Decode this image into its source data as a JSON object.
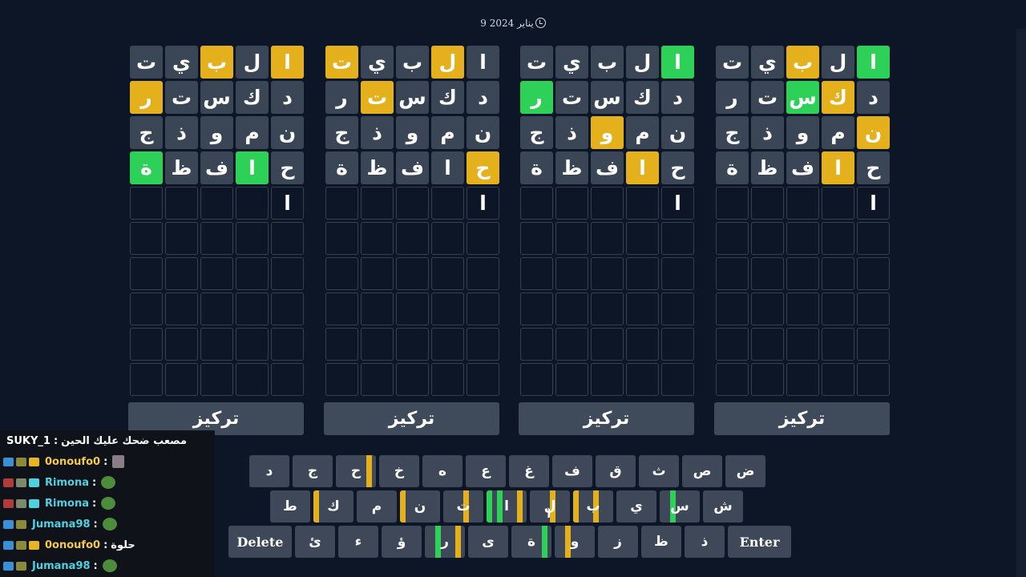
{
  "header": {
    "date": "9 يناير 2024",
    "clock_icon": "clock-icon"
  },
  "colors": {
    "background": "#0d1626",
    "tile_gray": "#3a4556",
    "tile_yellow": "#e4b01c",
    "tile_green": "#2ed158",
    "key": "#3e4859"
  },
  "boards": [
    {
      "focus_label": "تركيز",
      "rows": [
        [
          {
            "l": "ا",
            "s": "yellow"
          },
          {
            "l": "ل",
            "s": "gray"
          },
          {
            "l": "ب",
            "s": "yellow"
          },
          {
            "l": "ي",
            "s": "gray"
          },
          {
            "l": "ت",
            "s": "gray"
          }
        ],
        [
          {
            "l": "د",
            "s": "gray"
          },
          {
            "l": "ك",
            "s": "gray"
          },
          {
            "l": "س",
            "s": "gray"
          },
          {
            "l": "ت",
            "s": "gray"
          },
          {
            "l": "ر",
            "s": "yellow"
          }
        ],
        [
          {
            "l": "ن",
            "s": "gray"
          },
          {
            "l": "م",
            "s": "gray"
          },
          {
            "l": "و",
            "s": "gray"
          },
          {
            "l": "ذ",
            "s": "gray"
          },
          {
            "l": "ج",
            "s": "gray"
          }
        ],
        [
          {
            "l": "ح",
            "s": "gray"
          },
          {
            "l": "ا",
            "s": "green"
          },
          {
            "l": "ف",
            "s": "gray"
          },
          {
            "l": "ظ",
            "s": "gray"
          },
          {
            "l": "ة",
            "s": "green"
          }
        ],
        [
          {
            "l": "ا",
            "s": "typed"
          },
          {
            "l": "",
            "s": "empty"
          },
          {
            "l": "",
            "s": "empty"
          },
          {
            "l": "",
            "s": "empty"
          },
          {
            "l": "",
            "s": "empty"
          }
        ]
      ]
    },
    {
      "focus_label": "تركيز",
      "rows": [
        [
          {
            "l": "ا",
            "s": "gray"
          },
          {
            "l": "ل",
            "s": "yellow"
          },
          {
            "l": "ب",
            "s": "gray"
          },
          {
            "l": "ي",
            "s": "gray"
          },
          {
            "l": "ت",
            "s": "yellow"
          }
        ],
        [
          {
            "l": "د",
            "s": "gray"
          },
          {
            "l": "ك",
            "s": "gray"
          },
          {
            "l": "س",
            "s": "gray"
          },
          {
            "l": "ت",
            "s": "yellow"
          },
          {
            "l": "ر",
            "s": "gray"
          }
        ],
        [
          {
            "l": "ن",
            "s": "gray"
          },
          {
            "l": "م",
            "s": "gray"
          },
          {
            "l": "و",
            "s": "gray"
          },
          {
            "l": "ذ",
            "s": "gray"
          },
          {
            "l": "ج",
            "s": "gray"
          }
        ],
        [
          {
            "l": "ح",
            "s": "yellow"
          },
          {
            "l": "ا",
            "s": "gray"
          },
          {
            "l": "ف",
            "s": "gray"
          },
          {
            "l": "ظ",
            "s": "gray"
          },
          {
            "l": "ة",
            "s": "gray"
          }
        ],
        [
          {
            "l": "ا",
            "s": "typed"
          },
          {
            "l": "",
            "s": "empty"
          },
          {
            "l": "",
            "s": "empty"
          },
          {
            "l": "",
            "s": "empty"
          },
          {
            "l": "",
            "s": "empty"
          }
        ]
      ]
    },
    {
      "focus_label": "تركيز",
      "rows": [
        [
          {
            "l": "ا",
            "s": "green"
          },
          {
            "l": "ل",
            "s": "gray"
          },
          {
            "l": "ب",
            "s": "gray"
          },
          {
            "l": "ي",
            "s": "gray"
          },
          {
            "l": "ت",
            "s": "gray"
          }
        ],
        [
          {
            "l": "د",
            "s": "gray"
          },
          {
            "l": "ك",
            "s": "gray"
          },
          {
            "l": "س",
            "s": "gray"
          },
          {
            "l": "ت",
            "s": "gray"
          },
          {
            "l": "ر",
            "s": "green"
          }
        ],
        [
          {
            "l": "ن",
            "s": "gray"
          },
          {
            "l": "م",
            "s": "gray"
          },
          {
            "l": "و",
            "s": "yellow"
          },
          {
            "l": "ذ",
            "s": "gray"
          },
          {
            "l": "ج",
            "s": "gray"
          }
        ],
        [
          {
            "l": "ح",
            "s": "gray"
          },
          {
            "l": "ا",
            "s": "yellow"
          },
          {
            "l": "ف",
            "s": "gray"
          },
          {
            "l": "ظ",
            "s": "gray"
          },
          {
            "l": "ة",
            "s": "gray"
          }
        ],
        [
          {
            "l": "ا",
            "s": "typed"
          },
          {
            "l": "",
            "s": "empty"
          },
          {
            "l": "",
            "s": "empty"
          },
          {
            "l": "",
            "s": "empty"
          },
          {
            "l": "",
            "s": "empty"
          }
        ]
      ]
    },
    {
      "focus_label": "تركيز",
      "rows": [
        [
          {
            "l": "ا",
            "s": "green"
          },
          {
            "l": "ل",
            "s": "gray"
          },
          {
            "l": "ب",
            "s": "yellow"
          },
          {
            "l": "ي",
            "s": "gray"
          },
          {
            "l": "ت",
            "s": "gray"
          }
        ],
        [
          {
            "l": "د",
            "s": "gray"
          },
          {
            "l": "ك",
            "s": "yellow"
          },
          {
            "l": "س",
            "s": "green"
          },
          {
            "l": "ت",
            "s": "gray"
          },
          {
            "l": "ر",
            "s": "gray"
          }
        ],
        [
          {
            "l": "ن",
            "s": "yellow"
          },
          {
            "l": "م",
            "s": "gray"
          },
          {
            "l": "و",
            "s": "gray"
          },
          {
            "l": "ذ",
            "s": "gray"
          },
          {
            "l": "ج",
            "s": "gray"
          }
        ],
        [
          {
            "l": "ح",
            "s": "gray"
          },
          {
            "l": "ا",
            "s": "yellow"
          },
          {
            "l": "ف",
            "s": "gray"
          },
          {
            "l": "ظ",
            "s": "gray"
          },
          {
            "l": "ة",
            "s": "gray"
          }
        ],
        [
          {
            "l": "ا",
            "s": "typed"
          },
          {
            "l": "",
            "s": "empty"
          },
          {
            "l": "",
            "s": "empty"
          },
          {
            "l": "",
            "s": "empty"
          },
          {
            "l": "",
            "s": "empty"
          }
        ]
      ]
    }
  ],
  "keyboard": {
    "row1": [
      {
        "k": "ض"
      },
      {
        "k": "ص"
      },
      {
        "k": "ث"
      },
      {
        "k": "ق"
      },
      {
        "k": "ف"
      },
      {
        "k": "غ"
      },
      {
        "k": "ع"
      },
      {
        "k": "ه"
      },
      {
        "k": "خ"
      },
      {
        "k": "ح",
        "marks": [
          "yellow",
          "",
          "",
          ""
        ]
      },
      {
        "k": "ج"
      },
      {
        "k": "د"
      }
    ],
    "row2": [
      {
        "k": "ش"
      },
      {
        "k": "س",
        "marks": [
          "",
          "",
          "green",
          ""
        ]
      },
      {
        "k": "ي"
      },
      {
        "k": "ب",
        "marks": [
          "",
          "yellow",
          "",
          "yellow"
        ]
      },
      {
        "k": "ل",
        "marks": [
          "",
          "yellow",
          "",
          ""
        ]
      },
      {
        "k": "ا",
        "marks": [
          "yellow",
          "",
          "green",
          "green"
        ]
      },
      {
        "k": "ت",
        "marks": [
          "",
          "yellow",
          "",
          ""
        ]
      },
      {
        "k": "ن",
        "marks": [
          "",
          "",
          "",
          "yellow"
        ]
      },
      {
        "k": "م"
      },
      {
        "k": "ك",
        "marks": [
          "",
          "",
          "",
          "yellow"
        ]
      },
      {
        "k": "ط"
      }
    ],
    "row3": [
      {
        "k": "Delete",
        "wide": true
      },
      {
        "k": "ئ"
      },
      {
        "k": "ء"
      },
      {
        "k": "ؤ"
      },
      {
        "k": "ر",
        "marks": [
          "yellow",
          "",
          "green",
          ""
        ]
      },
      {
        "k": "ى"
      },
      {
        "k": "ة",
        "marks": [
          "green",
          "",
          "",
          ""
        ]
      },
      {
        "k": "و",
        "marks": [
          "",
          "",
          "yellow",
          ""
        ]
      },
      {
        "k": "ز"
      },
      {
        "k": "ظ"
      },
      {
        "k": "ذ"
      },
      {
        "k": "Enter",
        "wide": true
      }
    ]
  },
  "chat": [
    {
      "user": "SUKY_1",
      "msg": "مصعب ضحك عليك الحين",
      "color": "#ffffff",
      "badges": [],
      "emote": ""
    },
    {
      "user": "0onoufo0",
      "msg": "",
      "color": "#f2c94c",
      "badges": [
        "#3b8fd6",
        "#8a8a3a",
        "#e7b521"
      ],
      "emote": "frame"
    },
    {
      "user": "Rimona",
      "msg": "",
      "color": "#4fd1e0",
      "badges": [
        "#b03b3b",
        "#7a8a6a",
        "#4fd1e0"
      ],
      "emote": "pepe"
    },
    {
      "user": "Rimona",
      "msg": "",
      "color": "#4fd1e0",
      "badges": [
        "#b03b3b",
        "#7a8a6a",
        "#4fd1e0"
      ],
      "emote": "pepe"
    },
    {
      "user": "Jumana98",
      "msg": "",
      "color": "#4fd1e0",
      "badges": [
        "#3b8fd6",
        "#8a8a3a"
      ],
      "emote": "pepe"
    },
    {
      "user": "0onoufo0",
      "msg": "حلوة",
      "color": "#f2c94c",
      "badges": [
        "#3b8fd6",
        "#8a8a3a",
        "#e7b521"
      ],
      "emote": ""
    },
    {
      "user": "Jumana98",
      "msg": "",
      "color": "#4fd1e0",
      "badges": [
        "#3b8fd6",
        "#8a8a3a"
      ],
      "emote": "pepe"
    }
  ]
}
